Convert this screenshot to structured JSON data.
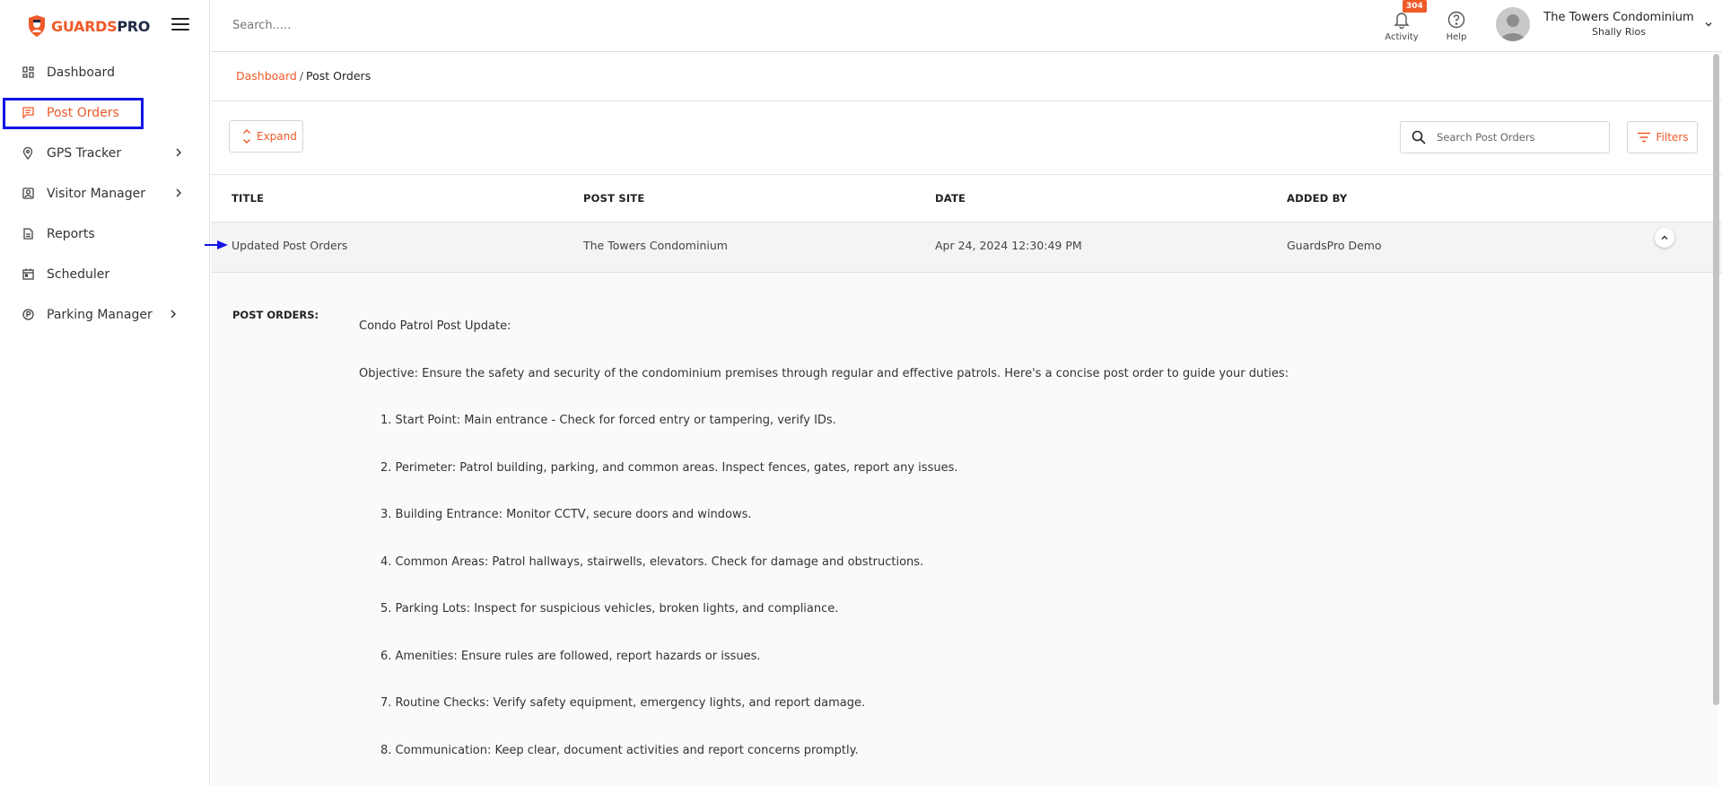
{
  "brand": {
    "name_part1": "GUARDS",
    "name_part2": "PRO"
  },
  "topbar": {
    "search_placeholder": "Search.....",
    "activity_label": "Activity",
    "activity_badge": "304",
    "help_label": "Help",
    "user_org": "The Towers Condominium",
    "user_name": "Shally Rios"
  },
  "sidebar": {
    "items": [
      {
        "label": "Dashboard",
        "icon": "dashboard-icon"
      },
      {
        "label": "Post Orders",
        "icon": "post-orders-icon",
        "active": true
      },
      {
        "label": "GPS Tracker",
        "icon": "location-pin-icon",
        "has_submenu": true
      },
      {
        "label": "Visitor Manager",
        "icon": "visitor-icon",
        "has_submenu": true
      },
      {
        "label": "Reports",
        "icon": "report-icon"
      },
      {
        "label": "Scheduler",
        "icon": "calendar-icon"
      },
      {
        "label": "Parking Manager",
        "icon": "parking-icon",
        "has_submenu": true
      }
    ]
  },
  "breadcrumb": {
    "root": "Dashboard",
    "separator": "/",
    "current": "Post Orders"
  },
  "toolbar": {
    "expand_label": "Expand",
    "search_placeholder": "Search Post Orders",
    "filters_label": "Filters"
  },
  "table": {
    "headers": [
      "TITLE",
      "POST SITE",
      "DATE",
      "ADDED BY"
    ],
    "rows": [
      {
        "title": "Updated Post Orders",
        "post_site": "The Towers Condominium",
        "date": "Apr 24, 2024 12:30:49 PM",
        "added_by": "GuardsPro Demo"
      }
    ]
  },
  "detail": {
    "label": "POST ORDERS:",
    "heading": "Condo Patrol Post Update:",
    "objective": "Objective: Ensure the safety and security of the condominium premises through regular and effective patrols. Here's a concise post order to guide your duties:",
    "items": [
      "1. Start Point: Main entrance - Check for forced entry or tampering, verify IDs.",
      "2. Perimeter: Patrol building, parking, and common areas. Inspect fences, gates, report any issues.",
      "3. Building Entrance: Monitor CCTV, secure doors and windows.",
      "4. Common Areas: Patrol hallways, stairwells, elevators. Check for damage and obstructions.",
      "5. Parking Lots: Inspect for suspicious vehicles, broken lights, and compliance.",
      "6. Amenities: Ensure rules are followed, report hazards or issues.",
      "7. Routine Checks: Verify safety equipment, emergency lights, and report damage.",
      "8. Communication: Keep clear, document activities and report concerns promptly."
    ]
  },
  "colors": {
    "accent": "#f05a28",
    "highlight": "#1313e6",
    "brand_dark": "#1f2a44"
  }
}
